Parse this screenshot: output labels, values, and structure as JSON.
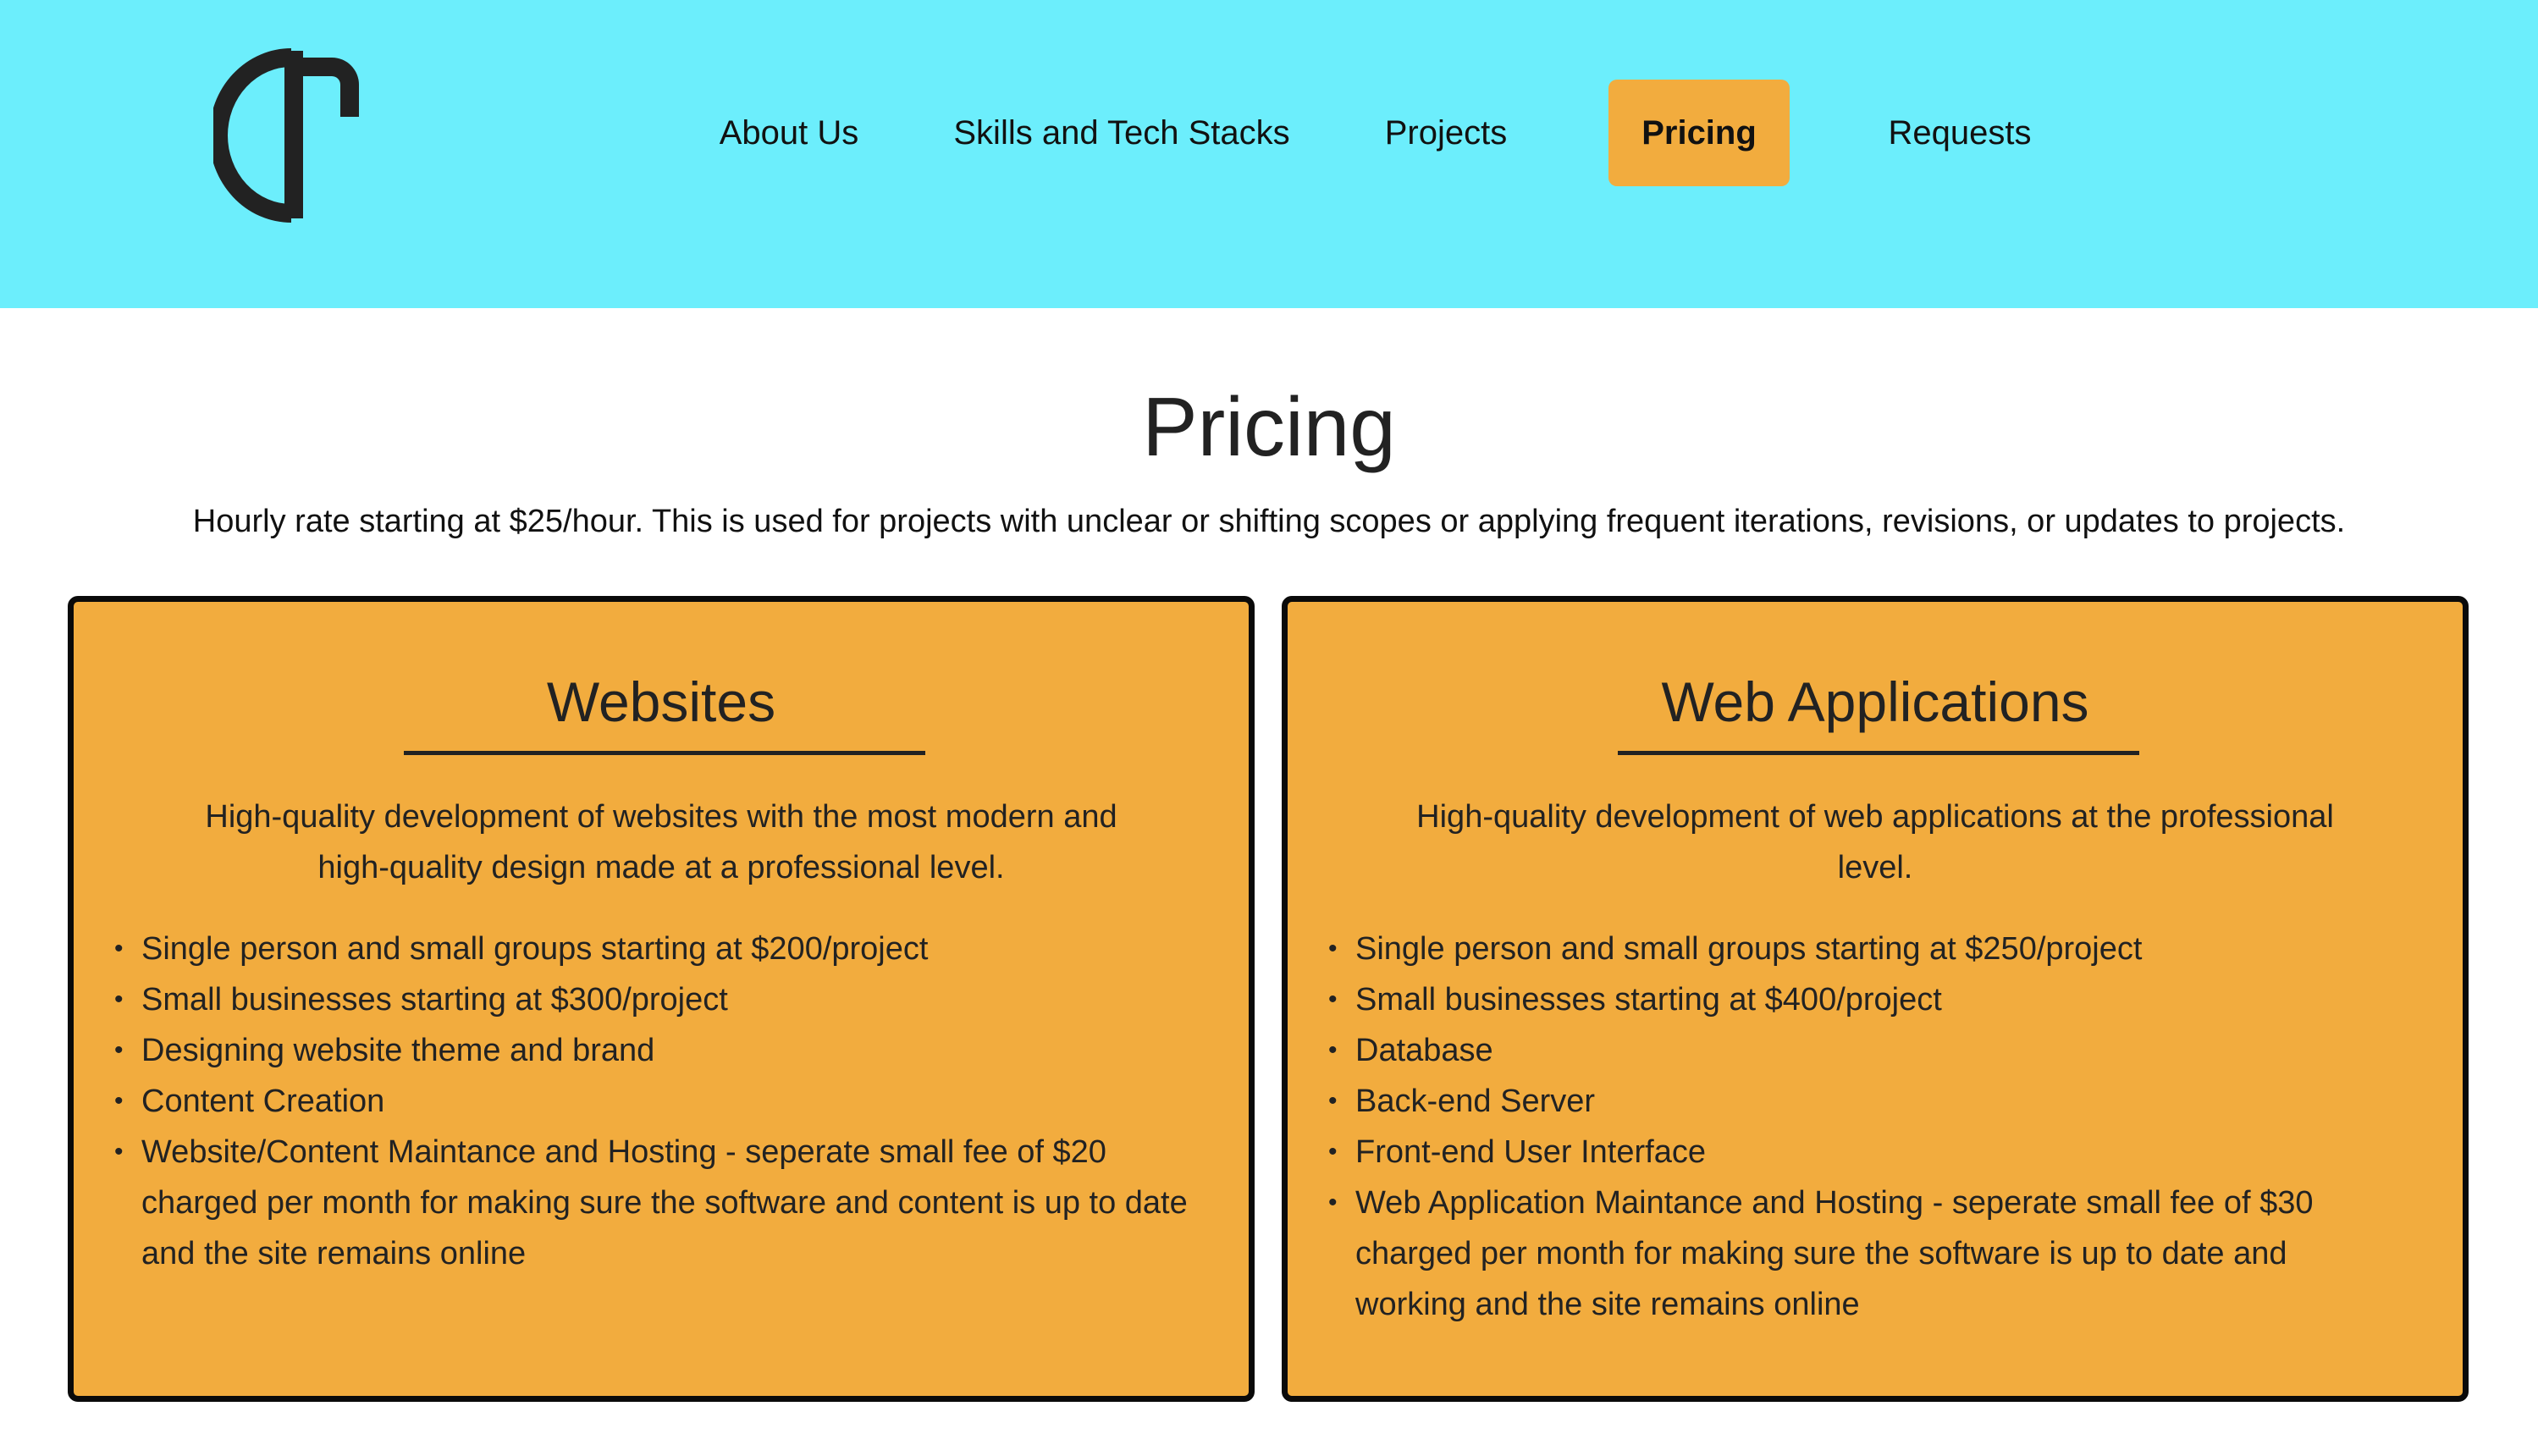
{
  "colors": {
    "header_bg": "#6ceefc",
    "accent": "#f2ac3e",
    "text": "#222222",
    "border": "#0a0a0a"
  },
  "logo": {
    "icon": "ct-monogram-logo"
  },
  "nav": {
    "items": [
      {
        "label": "About Us"
      },
      {
        "label": "Skills and Tech Stacks"
      },
      {
        "label": "Projects"
      },
      {
        "label": "Pricing",
        "active": true
      },
      {
        "label": "Requests"
      }
    ]
  },
  "main": {
    "title": "Pricing",
    "intro": "Hourly rate starting at $25/hour. This is used for projects with unclear or shifting scopes or applying frequent iterations, revisions, or updates to projects."
  },
  "cards": [
    {
      "title": "Websites",
      "description": "High-quality development of websites with the most modern and high-quality design made at a professional level.",
      "items": [
        "Single person and small groups starting at $200/project",
        "Small businesses starting at $300/project",
        "Designing website theme and brand",
        "Content Creation",
        "Website/Content Maintance and Hosting - seperate small fee of $20 charged per month for making sure the software and content is up to date and the site remains online"
      ]
    },
    {
      "title": "Web Applications",
      "description": "High-quality development of web applications at the professional level.",
      "items": [
        "Single person and small groups starting at $250/project",
        "Small businesses starting at $400/project",
        "Database",
        "Back-end Server",
        "Front-end User Interface",
        "Web Application Maintance and Hosting - seperate small fee of $30 charged per month for making sure the software is up to date and working and the site remains online"
      ]
    }
  ]
}
